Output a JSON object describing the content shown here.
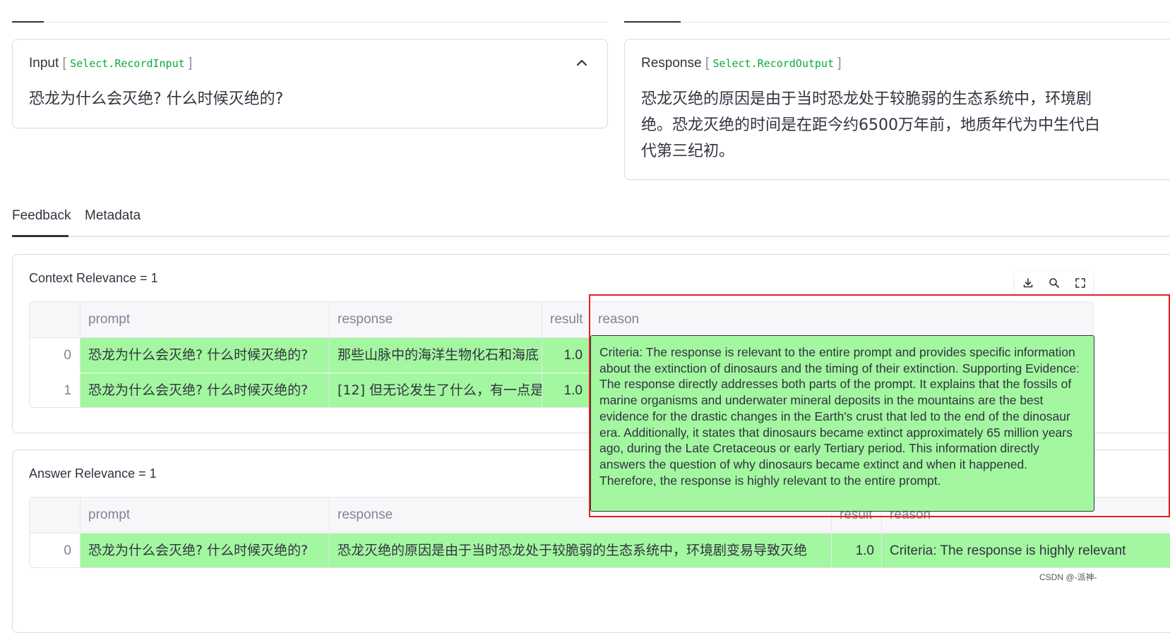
{
  "input_card": {
    "title": "Input",
    "component": "Select.RecordInput",
    "text": "恐龙为什么会灭绝? 什么时候灭绝的?"
  },
  "response_card": {
    "title": "Response",
    "component": "Select.RecordOutput",
    "lines": [
      "恐龙灭绝的原因是由于当时恐龙处于较脆弱的生态系统中，环境剧",
      "绝。恐龙灭绝的时间是在距今约6500万年前，地质年代为中生代白",
      "代第三纪初。"
    ]
  },
  "tabs": [
    {
      "label": "Feedback",
      "active": true
    },
    {
      "label": "Metadata",
      "active": false
    }
  ],
  "context_relevance": {
    "label": "Context Relevance = 1",
    "columns": [
      "prompt",
      "response",
      "result",
      "reason"
    ],
    "rows": [
      {
        "index": "0",
        "prompt": "恐龙为什么会灭绝? 什么时候灭绝的?",
        "response": "那些山脉中的海洋生物化石和海底",
        "result": "1.0"
      },
      {
        "index": "1",
        "prompt": "恐龙为什么会灭绝? 什么时候灭绝的?",
        "response": "[12] 但无论发生了什么，有一点是",
        "result": "1.0"
      }
    ]
  },
  "answer_relevance": {
    "label": "Answer Relevance = 1",
    "columns": [
      "prompt",
      "response",
      "result",
      "reason"
    ],
    "rows": [
      {
        "index": "0",
        "prompt": "恐龙为什么会灭绝? 什么时候灭绝的?",
        "response": "恐龙灭绝的原因是由于当时恐龙处于较脆弱的生态系统中，环境剧变易导致灭绝",
        "result": "1.0",
        "reason": "Criteria: The response is highly relevant"
      }
    ]
  },
  "reason_popup": {
    "text": "Criteria: The response is relevant to the entire prompt and provides specific information about the extinction of dinosaurs and the timing of their extinction. Supporting Evidence: The response directly addresses both parts of the prompt. It explains that the fossils of marine organisms and underwater mineral deposits in the mountains are the best evidence for the drastic changes in the Earth's crust that led to the end of the dinosaur era. Additionally, it states that dinosaurs became extinct approximately 65 million years ago, during the Late Cretaceous or early Tertiary period. This information directly answers the question of why dinosaurs became extinct and when it happened. Therefore, the response is highly relevant to the entire prompt."
  },
  "toolbar": {
    "icons": [
      "download-icon",
      "search-icon",
      "fullscreen-icon"
    ]
  },
  "watermark": "CSDN @-派神-",
  "colors": {
    "cell_highlight": "#a3f7a0",
    "code_text": "#09ab3b",
    "annotation_box": "#e5211f"
  }
}
